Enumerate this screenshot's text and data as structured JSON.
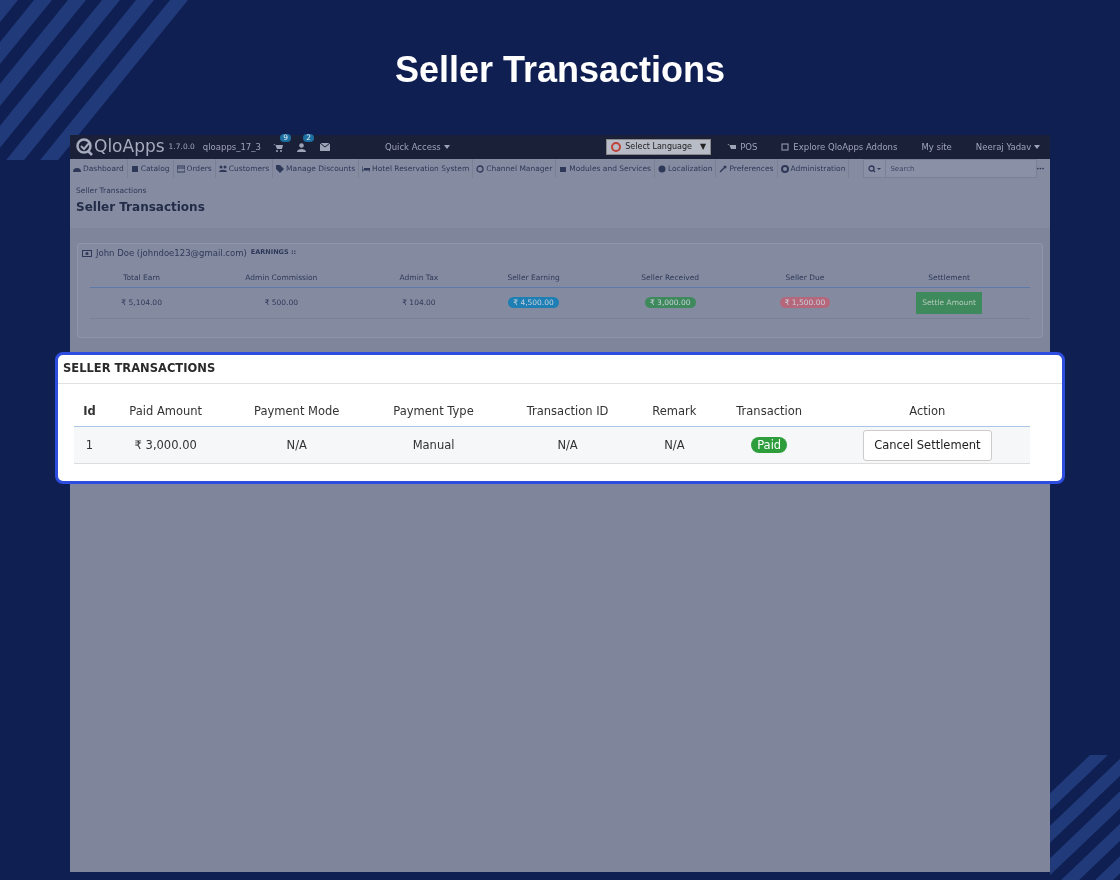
{
  "title": "Seller Transactions",
  "header": {
    "logo": "QloApps",
    "version": "1.7.0.0",
    "shop": "qloapps_17_3",
    "cart_count": "9",
    "customer_count": "2",
    "quick_access": "Quick Access",
    "language": "Select Language",
    "language_arrow": "▼",
    "pos": "POS",
    "addons": "Explore QloApps Addons",
    "my_site": "My site",
    "user": "Neeraj Yadav"
  },
  "menu": [
    "Dashboard",
    "Catalog",
    "Orders",
    "Customers",
    "Manage Discounts",
    "Hotel Reservation System",
    "Channel Manager",
    "Modules and Services",
    "Localization",
    "Preferences",
    "Administration"
  ],
  "search": {
    "placeholder": "Search"
  },
  "breadcrumb": "Seller Transactions",
  "page_heading": "Seller Transactions",
  "earnings": {
    "seller": "John Doe (johndoe123@gmail.com)",
    "label": "EARNINGS ::",
    "columns": [
      "Total Earn",
      "Admin Commission",
      "Admin Tax",
      "Seller Earning",
      "Seller Received",
      "Seller Due",
      "Settlement"
    ],
    "cells": [
      {
        "kind": "plain",
        "text": "₹ 5,104.00"
      },
      {
        "kind": "plain",
        "text": "₹ 500.00"
      },
      {
        "kind": "plain",
        "text": "₹ 104.00"
      },
      {
        "kind": "badge",
        "text": "₹ 4,500.00",
        "color": "#1d7fb3"
      },
      {
        "kind": "badge",
        "text": "₹ 3,000.00",
        "color": "#3f8a5c"
      },
      {
        "kind": "badge",
        "text": "₹ 1,500.00",
        "color": "#b5687b"
      },
      {
        "kind": "button",
        "text": "Settle Amount"
      }
    ]
  },
  "transactions": {
    "title": "SELLER TRANSACTIONS",
    "columns": [
      "Id",
      "Paid Amount",
      "Payment Mode",
      "Payment Type",
      "Transaction ID",
      "Remark",
      "Transaction",
      "Action"
    ],
    "rows": [
      {
        "id": "1",
        "paid_amount": "₹ 3,000.00",
        "payment_mode": "N/A",
        "payment_type": "Manual",
        "transaction_id": "N/A",
        "remark": "N/A",
        "status": "Paid",
        "action": "Cancel Settlement"
      }
    ]
  }
}
